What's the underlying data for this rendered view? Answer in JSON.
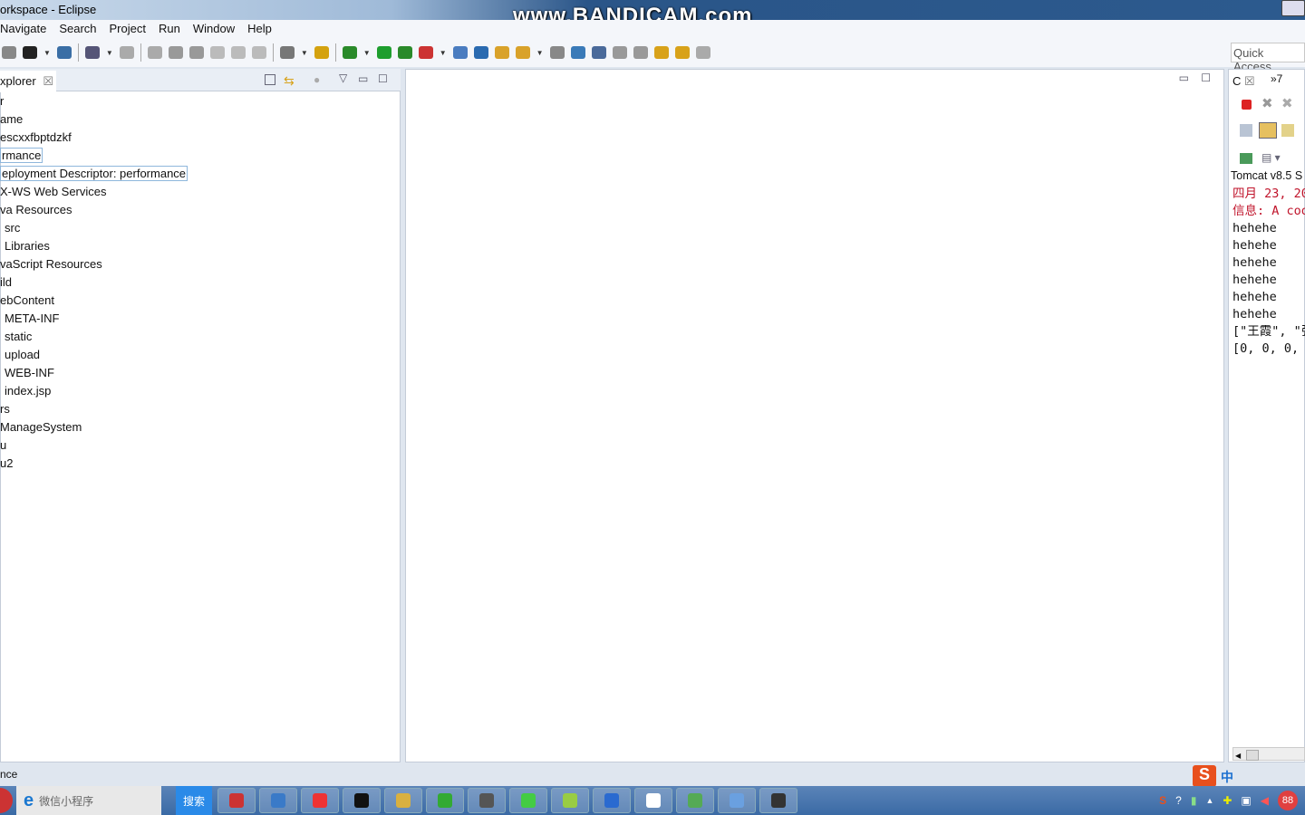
{
  "window": {
    "title": "orkspace - Eclipse",
    "watermark": "www.BANDICAM.com"
  },
  "menu": [
    "Navigate",
    "Search",
    "Project",
    "Run",
    "Window",
    "Help"
  ],
  "toolbar": {
    "quick_access": "Quick Access",
    "icon_colors": [
      "#888",
      "#222",
      "#3a6ea5",
      "#557",
      "#aaa",
      "#aaa",
      "#999",
      "#999",
      "#bbb",
      "#bbb",
      "#bbb",
      "#777",
      "#d4a20f",
      "#2a8a2a",
      "#1e9e2e",
      "#2a8a2a",
      "#c33",
      "#4a7cc0",
      "#2a6ab0",
      "#d9a22a",
      "#d9a22a",
      "#888",
      "#3a7ab8",
      "#4a6a9a",
      "#999",
      "#999",
      "#d8a21a",
      "#d8a21a",
      "#aaa"
    ]
  },
  "explorer": {
    "tab_label": "xplorer",
    "tree": [
      {
        "label": "r",
        "indent": 0
      },
      {
        "label": "ame",
        "indent": 0
      },
      {
        "label": "escxxfbptdzkf",
        "indent": 0
      },
      {
        "label": "rmance",
        "indent": 0,
        "selected": true
      },
      {
        "label": "eployment Descriptor: performance",
        "indent": 0,
        "selected": true
      },
      {
        "label": "X-WS Web Services",
        "indent": 0
      },
      {
        "label": "va Resources",
        "indent": 0
      },
      {
        "label": "src",
        "indent": 1
      },
      {
        "label": "Libraries",
        "indent": 1
      },
      {
        "label": "vaScript Resources",
        "indent": 0
      },
      {
        "label": "ild",
        "indent": 0
      },
      {
        "label": "ebContent",
        "indent": 0
      },
      {
        "label": "META-INF",
        "indent": 1
      },
      {
        "label": "static",
        "indent": 1
      },
      {
        "label": "upload",
        "indent": 1
      },
      {
        "label": "WEB-INF",
        "indent": 1
      },
      {
        "label": "index.jsp",
        "indent": 1
      },
      {
        "label": "rs",
        "indent": 0
      },
      {
        "label": "ManageSystem",
        "indent": 0
      },
      {
        "label": "u",
        "indent": 0
      },
      {
        "label": "u2",
        "indent": 0
      }
    ]
  },
  "console": {
    "tab_label": "C",
    "overflow": "»7",
    "server": "Tomcat v8.5 S",
    "lines": [
      {
        "text": "四月 23, 20",
        "red": true
      },
      {
        "text": "信息: A coo",
        "red": true
      },
      {
        "text": "hehehe"
      },
      {
        "text": "hehehe"
      },
      {
        "text": "hehehe"
      },
      {
        "text": "hehehe"
      },
      {
        "text": "hehehe"
      },
      {
        "text": "hehehe"
      },
      {
        "text": "[\"王霞\", \"张"
      },
      {
        "text": "[0, 0, 0,"
      }
    ]
  },
  "status": {
    "text": "nce"
  },
  "taskbar": {
    "ie_label": "微信小程序",
    "search_label": "搜索",
    "tray_badge": "88",
    "ime": "中"
  }
}
